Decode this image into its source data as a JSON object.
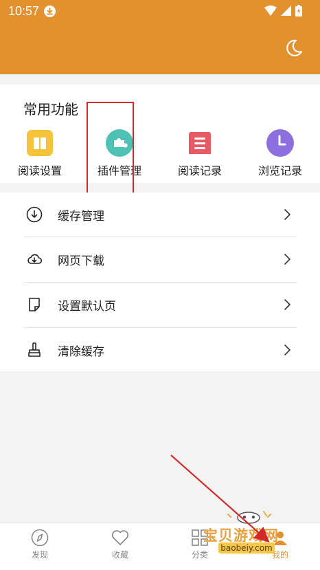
{
  "status_bar": {
    "time": "10:57"
  },
  "colors": {
    "accent": "#e3902f",
    "highlight_box": "#d22a2a",
    "arrow": "#d22a2a"
  },
  "common_functions": {
    "title": "常用功能",
    "items": [
      {
        "label": "阅读设置",
        "icon": "book-icon",
        "color": "#f5c23b"
      },
      {
        "label": "插件管理",
        "icon": "puzzle-icon",
        "color": "#4cc1b4"
      },
      {
        "label": "阅读记录",
        "icon": "list-icon",
        "color": "#e85a63"
      },
      {
        "label": "浏览记录",
        "icon": "clock-icon",
        "color": "#8e6fe0"
      }
    ]
  },
  "menu": [
    {
      "label": "缓存管理",
      "icon": "download-circle-icon"
    },
    {
      "label": "网页下载",
      "icon": "cloud-download-icon"
    },
    {
      "label": "设置默认页",
      "icon": "page-icon"
    },
    {
      "label": "清除缓存",
      "icon": "brush-icon"
    }
  ],
  "bottom_nav": [
    {
      "label": "发现",
      "icon": "compass-icon",
      "active": false
    },
    {
      "label": "收藏",
      "icon": "heart-icon",
      "active": false
    },
    {
      "label": "分类",
      "icon": "grid-icon",
      "active": false
    },
    {
      "label": "我的",
      "icon": "user-icon",
      "active": true
    }
  ],
  "watermark": {
    "text": "宝贝游戏网",
    "url": "baobeiy.com"
  }
}
